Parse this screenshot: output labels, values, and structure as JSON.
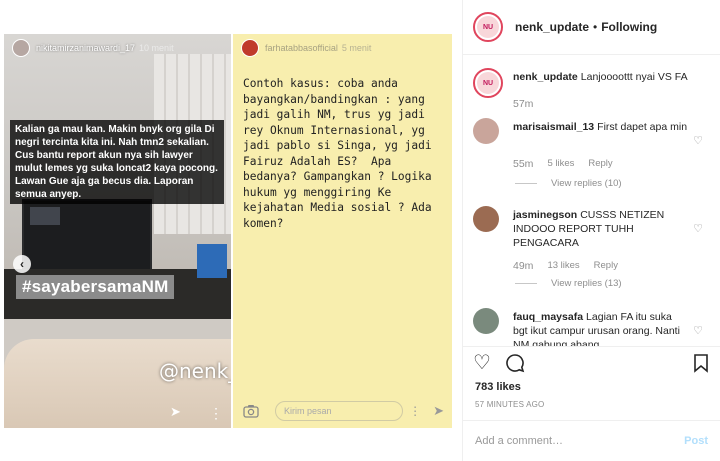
{
  "left_story": {
    "username": "nikitamirzanimawardi_17",
    "time": "10 menit",
    "caption": "Kalian ga mau kan. Makin bnyk org gila Di negri tercinta kita ini. Nah tmn2 sekalian. Cus bantu report akun nya sih lawyer mulut lemes yg suka loncat2 kaya pocong. Lawan Gue aja ga becus dia. Laporan semua anyep.",
    "hashtag": "#sayabersamaNM",
    "watermark": "@nenk_update"
  },
  "right_story": {
    "username": "farhatabbasofficial",
    "time": "5 menit",
    "text": "Contoh kasus: coba anda bayangkan/bandingkan : yang jadi galih NM, trus yg jadi rey Oknum Internasional, yg jadi pablo si Singa, yg jadi Fairuz Adalah ES?  Apa bedanya? Gampangkan ? Logika hukum yg menggiring Ke kejahatan Media sosial ? Ada komen?",
    "reply_placeholder": "Kirim pesan"
  },
  "header": {
    "username": "nenk_update",
    "separator": "•",
    "follow_status": "Following"
  },
  "comments": [
    {
      "username": "nenk_update",
      "text": "Lanjoooottt nyai VS FA",
      "time": "57m",
      "likes": "",
      "reply": "",
      "view_replies": ""
    },
    {
      "username": "marisaismail_13",
      "text": "First dapet apa min",
      "time": "55m",
      "likes": "5 likes",
      "reply": "Reply",
      "view_replies": "View replies (10)"
    },
    {
      "username": "jasminegson",
      "text": "CUSSS NETIZEN INDOOO REPORT TUHH PENGACARA",
      "time": "49m",
      "likes": "13 likes",
      "reply": "Reply",
      "view_replies": "View replies (13)"
    },
    {
      "username": "fauq_maysafa",
      "text": "Lagian FA itu suka bgt ikut campur urusan orang. Nanti NM gabung abang",
      "time": "",
      "likes": "",
      "reply": "",
      "view_replies": ""
    }
  ],
  "likes": "783 likes",
  "post_time": "57 MINUTES AGO",
  "add_comment": {
    "placeholder": "Add a comment…",
    "post_label": "Post"
  },
  "icons": {
    "heart": "heart-icon",
    "comment": "comment-icon",
    "bookmark": "bookmark-icon",
    "prev": "chevron-left-icon",
    "send": "send-icon",
    "more": "more-icon",
    "camera": "camera-icon"
  },
  "colors": {
    "post_button": "#b2dffc",
    "meta_text": "#8e8e8e",
    "story_bg": "#f8eeae"
  }
}
